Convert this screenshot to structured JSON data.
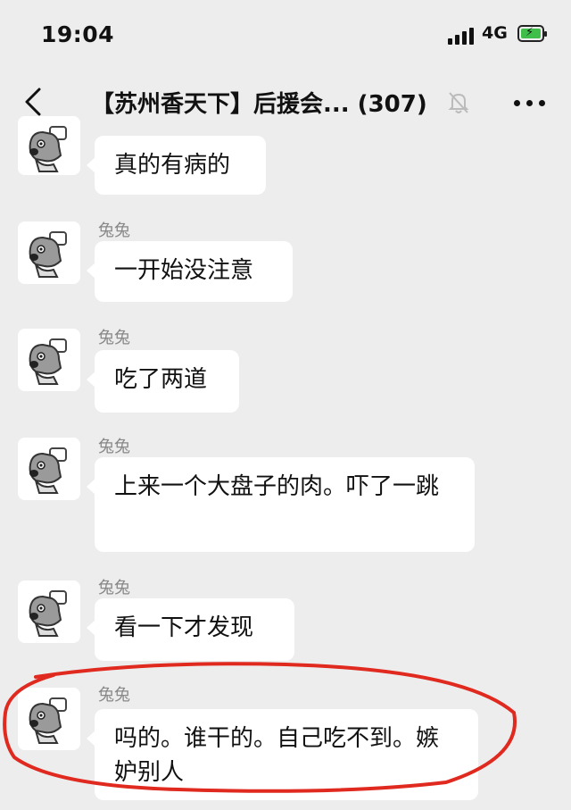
{
  "status_bar": {
    "time": "19:04",
    "network": "4G"
  },
  "header": {
    "title": "【苏州香天下】后援会... (307)"
  },
  "messages": [
    {
      "sender": "",
      "text": "真的有病的"
    },
    {
      "sender": "兔兔",
      "text": "一开始没注意"
    },
    {
      "sender": "兔兔",
      "text": "吃了两道"
    },
    {
      "sender": "兔兔",
      "text": "上来一个大盘子的肉。吓了一跳"
    },
    {
      "sender": "兔兔",
      "text": "看一下才发现"
    },
    {
      "sender": "兔兔",
      "text": "吗的。谁干的。自己吃不到。嫉妒别人"
    }
  ],
  "colors": {
    "background": "#ededed",
    "bubble": "#ffffff",
    "highlight": "#e0291f",
    "battery": "#3fbf4a"
  }
}
